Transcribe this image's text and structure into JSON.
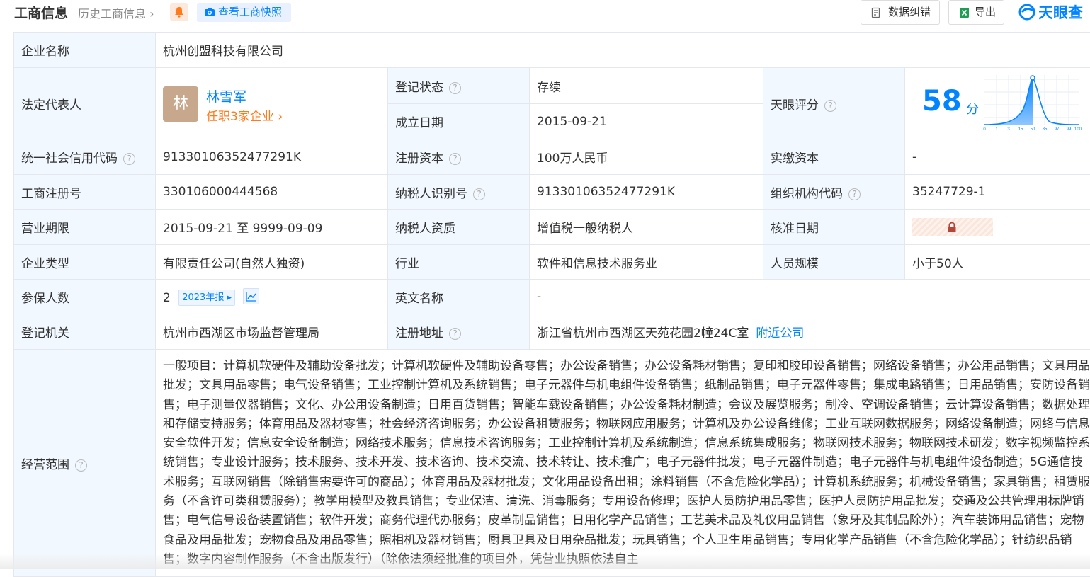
{
  "header": {
    "title": "工商信息",
    "history_link": "历史工商信息",
    "snapshot_button": "查看工商快照",
    "correct_button": "数据纠错",
    "export_button": "导出",
    "brand": "天眼查"
  },
  "company": {
    "name_label": "企业名称",
    "name": "杭州创盟科技有限公司",
    "legal_rep_label": "法定代表人",
    "legal_rep_avatar": "林",
    "legal_rep_name": "林雪军",
    "legal_rep_jobs": "任职3家企业",
    "status_label": "登记状态",
    "status": "存续",
    "founded_label": "成立日期",
    "founded": "2015-09-21",
    "score_label": "天眼评分",
    "score": "58",
    "score_unit": "分",
    "score_axis": [
      "0",
      "1",
      "3",
      "15",
      "50",
      "85",
      "97",
      "99",
      "100"
    ],
    "credit_code_label": "统一社会信用代码",
    "credit_code": "91330106352477291K",
    "reg_capital_label": "注册资本",
    "reg_capital": "100万人民币",
    "paid_capital_label": "实缴资本",
    "paid_capital": "-",
    "reg_no_label": "工商注册号",
    "reg_no": "330106000444568",
    "taxpayer_id_label": "纳税人识别号",
    "taxpayer_id": "91330106352477291K",
    "org_code_label": "组织机构代码",
    "org_code": "35247729-1",
    "term_label": "营业期限",
    "term": "2015-09-21 至 9999-09-09",
    "tax_qual_label": "纳税人资质",
    "tax_qual": "增值税一般纳税人",
    "approve_date_label": "核准日期",
    "type_label": "企业类型",
    "type": "有限责任公司(自然人独资)",
    "industry_label": "行业",
    "industry": "软件和信息技术服务业",
    "staff_label": "人员规模",
    "staff": "小于50人",
    "insured_label": "参保人数",
    "insured": "2",
    "insured_tag": "2023年报",
    "english_name_label": "英文名称",
    "english_name": "-",
    "authority_label": "登记机关",
    "authority": "杭州市西湖区市场监督管理局",
    "address_label": "注册地址",
    "address": "浙江省杭州市西湖区天苑花园2幢24C室",
    "nearby_link": "附近公司",
    "scope_label": "经营范围",
    "scope": "一般项目：计算机软硬件及辅助设备批发；计算机软硬件及辅助设备零售；办公设备销售；办公设备耗材销售；复印和胶印设备销售；网络设备销售；办公用品销售；文具用品批发；文具用品零售；电气设备销售；工业控制计算机及系统销售；电子元器件与机电组件设备销售；纸制品销售；电子元器件零售；集成电路销售；日用品销售；安防设备销售；电子测量仪器销售；文化、办公用设备制造；日用百货销售；智能车载设备销售；办公设备耗材制造；会议及展览服务；制冷、空调设备销售；云计算设备销售；数据处理和存储支持服务；体育用品及器材零售；社会经济咨询服务；办公设备租赁服务；物联网应用服务；计算机及办公设备维修；工业互联网数据服务；网络设备制造；网络与信息安全软件开发；信息安全设备制造；网络技术服务；信息技术咨询服务；工业控制计算机及系统制造；信息系统集成服务；物联网技术服务；物联网技术研发；数字视频监控系统销售；专业设计服务；技术服务、技术开发、技术咨询、技术交流、技术转让、技术推广；电子元器件批发；电子元器件制造；电子元器件与机电组件设备制造；5G通信技术服务；互联网销售（除销售需要许可的商品）；体育用品及器材批发；文化用品设备出租；涂料销售（不含危险化学品）；计算机系统服务；机械设备销售；家具销售；租赁服务（不含许可类租赁服务）；教学用模型及教具销售；专业保洁、清洗、消毒服务；专用设备修理；医护人员防护用品零售；医护人员防护用品批发；交通及公共管理用标牌销售；电气信号设备装置销售；软件开发；商务代理代办服务；皮革制品销售；日用化学产品销售；工艺美术品及礼仪用品销售（象牙及其制品除外）；汽车装饰用品销售；宠物食品及用品批发；宠物食品及用品零售；照相机及器材销售；厨具卫具及日用杂品批发；玩具销售；个人卫生用品销售；专用化学产品销售（不含危险化学品）；针纺织品销售；数字内容制作服务（不含出版发行）（除依法须经批准的项目外，凭营业执照依法自主"
  },
  "colors": {
    "accent": "#0084ff",
    "label_bg": "#f2f8ff",
    "status_green": "#2bab4d",
    "orange": "#ff7a1a"
  }
}
